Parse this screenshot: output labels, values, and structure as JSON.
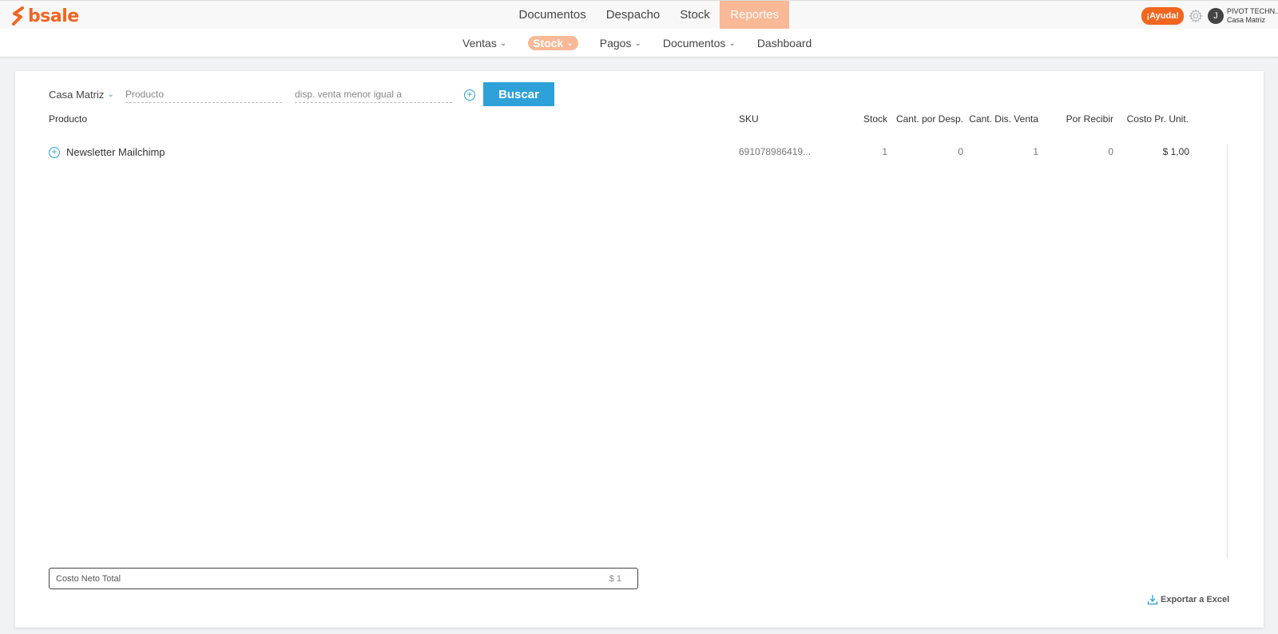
{
  "brand": {
    "name": "bsale",
    "color": "#f26522"
  },
  "main_nav": [
    {
      "label": "Documentos"
    },
    {
      "label": "Despacho"
    },
    {
      "label": "Stock"
    },
    {
      "label": "Reportes",
      "active": true
    }
  ],
  "top_right": {
    "help_label": "¡Ayuda!",
    "avatar_initial": "J",
    "company_name": "PIVOT TECHN...",
    "branch_name": "Casa Matriz"
  },
  "sub_nav": [
    {
      "label": "Ventas",
      "chevron": true
    },
    {
      "label": "Stock",
      "chevron": true,
      "active": true
    },
    {
      "label": "Pagos",
      "chevron": true
    },
    {
      "label": "Documentos",
      "chevron": true
    },
    {
      "label": "Dashboard",
      "chevron": false
    }
  ],
  "filters": {
    "branch": "Casa Matriz",
    "product_placeholder": "Producto",
    "disp_placeholder": "disp. venta menor igual a",
    "search_label": "Buscar"
  },
  "table": {
    "headers": {
      "product": "Producto",
      "sku": "SKU",
      "stock": "Stock",
      "cant_desp": "Cant. por Desp.",
      "cant_dis": "Cant. Dis. Venta",
      "por_recibir": "Por Recibir",
      "costo": "Costo Pr. Unit."
    },
    "rows": [
      {
        "product": "Newsletter Mailchimp",
        "sku": "691078986419...",
        "stock": "1",
        "cant_desp": "0",
        "cant_dis": "1",
        "por_recibir": "0",
        "costo": "$ 1,00"
      }
    ]
  },
  "total": {
    "label": "Costo Neto Total",
    "value": "$ 1"
  },
  "export_label": "Exportar a Excel",
  "colors": {
    "accent": "#f9b896",
    "primary": "#2ea1d8",
    "help": "#f2661f"
  }
}
